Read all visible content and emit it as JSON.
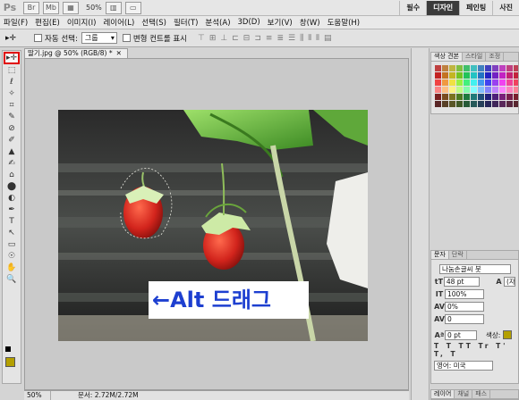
{
  "app": {
    "logo": "Ps",
    "zoom": "50%",
    "toolbar_icons": [
      "br-icon",
      "mb-icon",
      "view-icon",
      "hand-icon",
      "arrange-icon",
      "screen-mode-icon"
    ],
    "workspaces": [
      {
        "label": "필수",
        "active": false
      },
      {
        "label": "디자인",
        "active": true
      },
      {
        "label": "페인팅",
        "active": false
      },
      {
        "label": "사진",
        "active": false
      }
    ]
  },
  "menu": [
    "파일(F)",
    "편집(E)",
    "이미지(I)",
    "레이어(L)",
    "선택(S)",
    "필터(T)",
    "분석(A)",
    "3D(D)",
    "보기(V)",
    "창(W)",
    "도움말(H)"
  ],
  "options": {
    "tool_glyph": "▸✛",
    "auto_select_label": "자동 선택:",
    "auto_select_value": "그룹",
    "transform_label": "변형 컨트롤 표시"
  },
  "tools": [
    "▸✛",
    "⬚",
    "ℓ",
    "✧",
    "⌗",
    "✎",
    "⊘",
    "✐",
    "▲",
    "✍",
    "⌂",
    "⬤",
    "◐",
    "✒",
    "T",
    "↖",
    "▭",
    "☉",
    "✋",
    "🔍"
  ],
  "document": {
    "tab_title": "딸기.jpg @ 50% (RGB/8) *",
    "annotation": "←Alt 드래그",
    "status_zoom": "50%",
    "status_doc": "문서: 2.72M/2.72M"
  },
  "panels": {
    "swatches_tabs": [
      "색상 견본",
      "스타일",
      "조정"
    ],
    "character_tabs": [
      "문자",
      "단락"
    ],
    "font_family": "나눔손글씨 붓",
    "font_size": "48 pt",
    "leading": "(자",
    "vertical_scale": "100%",
    "tracking": "0%",
    "baseline": "0",
    "baseline_shift": "0 pt",
    "color_label": "색상:",
    "language": "영어: 미국",
    "layers_tabs": [
      "레이어",
      "채널",
      "패스"
    ]
  },
  "colors": {
    "accent_dark": "#3b3b3b",
    "annotation_text": "#1d3fd0",
    "fg_swatch": "#b4a000"
  }
}
